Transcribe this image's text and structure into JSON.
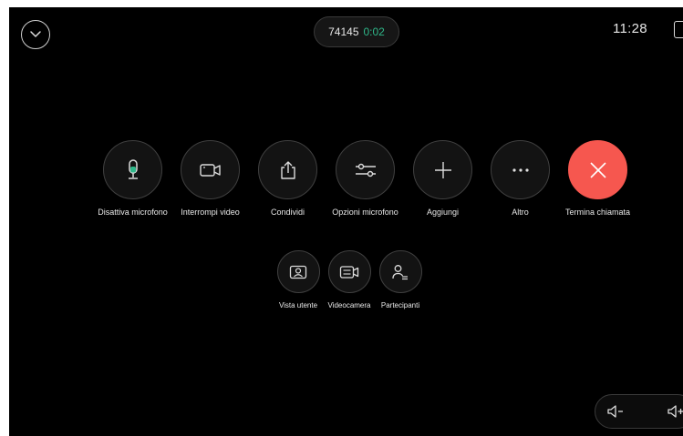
{
  "header": {
    "call_number": "74145",
    "call_timer": "0:02",
    "clock": "11:28"
  },
  "colors": {
    "background": "#000000",
    "end_call": "#f6574f",
    "mic_active": "#2fb88a"
  },
  "controls": [
    {
      "label": "Disattiva microfono",
      "icon": "microphone-icon"
    },
    {
      "label": "Interrompi video",
      "icon": "video-camera-icon"
    },
    {
      "label": "Condividi",
      "icon": "share-icon"
    },
    {
      "label": "Opzioni microfono",
      "icon": "sliders-icon"
    },
    {
      "label": "Aggiungi",
      "icon": "plus-icon"
    },
    {
      "label": "Altro",
      "icon": "more-icon"
    },
    {
      "label": "Termina chiamata",
      "icon": "close-icon"
    }
  ],
  "secondary_controls": [
    {
      "label": "Vista utente",
      "icon": "self-view-icon"
    },
    {
      "label": "Videocamera",
      "icon": "camera-control-icon"
    },
    {
      "label": "Partecipanti",
      "icon": "participants-icon"
    }
  ],
  "volume": {
    "down_icon": "volume-down-icon",
    "up_icon": "volume-up-icon"
  }
}
